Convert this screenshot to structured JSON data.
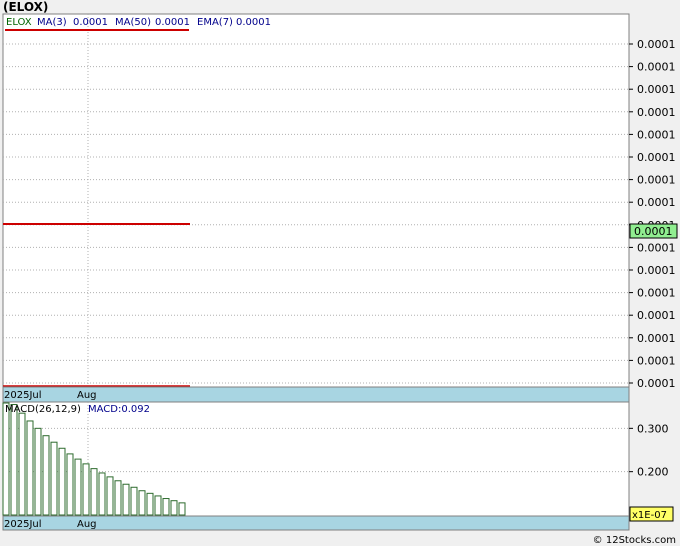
{
  "header": {
    "ticker": "(ELOX)"
  },
  "legend": {
    "symbol": "ELOX",
    "ma3_label": "MA(3)",
    "ma3_value": "0.0001",
    "ma50_label": "MA(50)",
    "ma50_value": "0.0001",
    "ema7_label": "EMA(7)",
    "ema7_value": "0.0001"
  },
  "macd_legend": {
    "params": "MACD(26,12,9)",
    "value": "MACD:0.092"
  },
  "footer": {
    "credit": "© 12Stocks.com"
  },
  "colors": {
    "background": "#f0f0f0",
    "plot_bg": "#ffffff",
    "grid": "#a0a0a0",
    "ma_line": "#cc0000",
    "macd_bar": "#2e6b2e",
    "date_strip": "#a8d5e2",
    "price_tag": "#90ee90",
    "multiplier_tag": "#ffff66",
    "text_dark": "#000000",
    "text_blue": "#00008b",
    "text_green": "#006400"
  },
  "chart_data": [
    {
      "type": "line",
      "panel": "price",
      "title": "(ELOX)",
      "x_tick_labels": [
        "2025Jul",
        "Aug"
      ],
      "y_tick_labels": [
        "0.0001",
        "0.0001",
        "0.0001",
        "0.0001",
        "0.0001",
        "0.0001",
        "0.0001",
        "0.0001",
        "0.0001",
        "0.0001",
        "0.0001",
        "0.0001",
        "0.0001",
        "0.0001",
        "0.0001",
        "0.0001"
      ],
      "current_price_label": "0.0001",
      "series": [
        {
          "name": "MA(3)",
          "values": [
            0.0001,
            0.0001,
            0.0001,
            0.0001,
            0.0001,
            0.0001,
            0.0001,
            0.0001,
            0.0001,
            0.0001,
            0.0001,
            0.0001,
            0.0001,
            0.0001,
            0.0001,
            0.0001,
            0.0001,
            0.0001,
            0.0001,
            0.0001,
            0.0001,
            0.0001,
            0.0001,
            0.0001,
            0.0001
          ]
        }
      ],
      "ylim": [
        0.0001,
        0.0001
      ],
      "grid": true
    },
    {
      "type": "bar",
      "panel": "macd",
      "x_tick_labels": [
        "2025Jul",
        "Aug"
      ],
      "y_tick_labels": [
        "0.300",
        "0.200"
      ],
      "multiplier_label": "x1E-07",
      "series": [
        {
          "name": "MACD",
          "values": [
            0.373,
            0.355,
            0.335,
            0.317,
            0.3,
            0.283,
            0.268,
            0.254,
            0.241,
            0.229,
            0.218,
            0.207,
            0.197,
            0.188,
            0.179,
            0.171,
            0.164,
            0.156,
            0.15,
            0.144,
            0.138,
            0.133,
            0.128
          ]
        }
      ],
      "ylim": [
        0.1,
        0.4
      ],
      "grid": true
    }
  ]
}
